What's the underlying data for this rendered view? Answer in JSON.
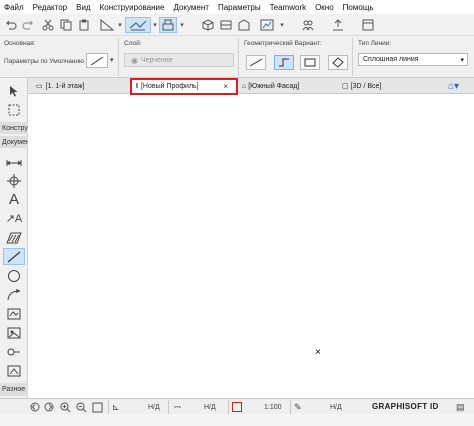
{
  "menu": {
    "items": [
      "Файл",
      "Редактор",
      "Вид",
      "Конструирование",
      "Документ",
      "Параметры",
      "Teamwork",
      "Окно",
      "Помощь"
    ]
  },
  "infobox": {
    "main_label": "Основная:",
    "default_params_label": "Параметры по Умолчанию",
    "layer_label": "Слой:",
    "layer_value": "Черчение",
    "geometry_label": "Геометрический Вариант:",
    "line_type_label": "Тип Линии:",
    "line_type_value": "Сплошная линия"
  },
  "tabs": {
    "floor": "[1. 1-й этаж]",
    "profile": "[Новый Профиль]",
    "facade": "[Южный Фасад]",
    "view3d": "[3D / Все]",
    "close_glyph": "×"
  },
  "toolbox": {
    "group_design": "Констру",
    "group_document": "Докумен",
    "group_more": "Разное"
  },
  "statusbar": {
    "nd1": "Н/Д",
    "nd2": "Н/Д",
    "scale": "1:100",
    "nd3": "Н/Д",
    "brand": "GRAPHISOFT ID"
  },
  "colors": {
    "active_tab_border": "#d71f1f",
    "selection": "#cfe3f7"
  }
}
